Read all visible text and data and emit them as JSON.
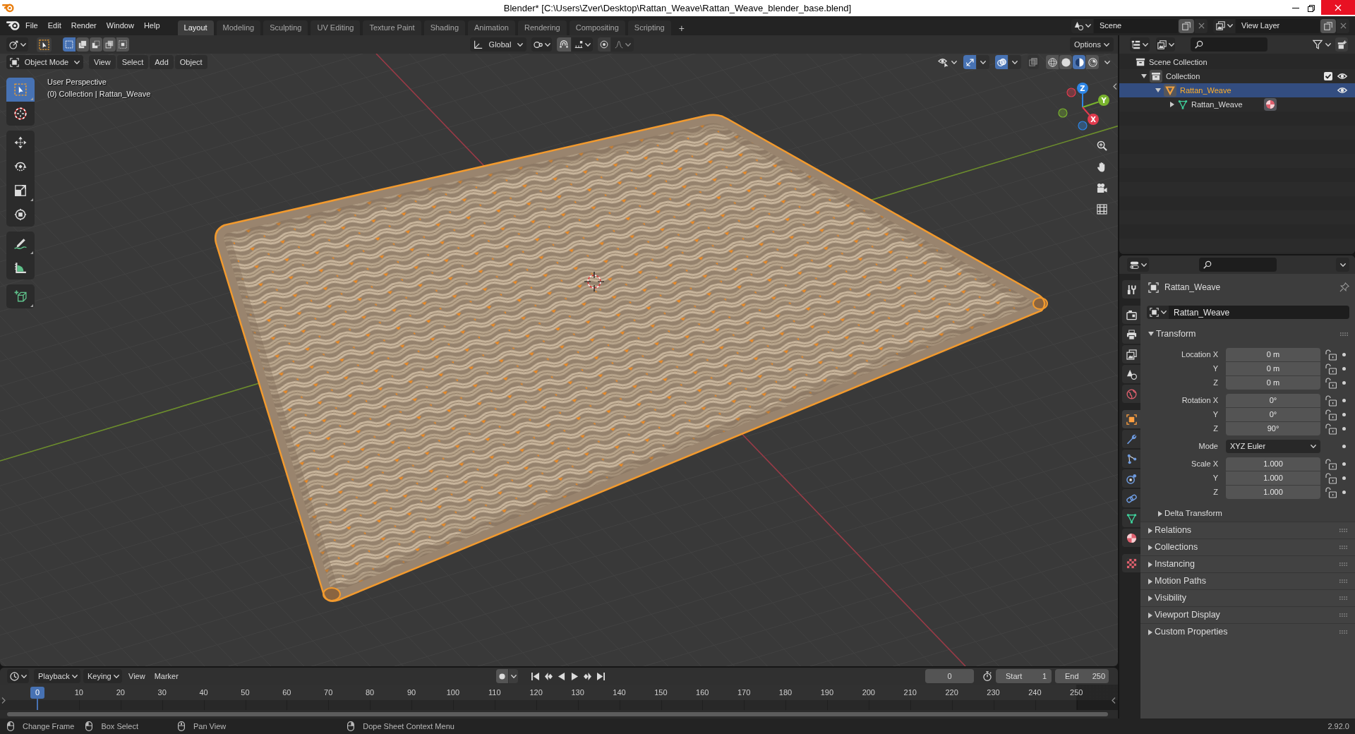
{
  "title_bar": {
    "title": "Blender* [C:\\Users\\Zver\\Desktop\\Rattan_Weave\\Rattan_Weave_blender_base.blend]"
  },
  "top_bar": {
    "menus": [
      "File",
      "Edit",
      "Render",
      "Window",
      "Help"
    ],
    "workspaces": [
      {
        "label": "Layout",
        "selected": true
      },
      {
        "label": "Modeling",
        "selected": false
      },
      {
        "label": "Sculpting",
        "selected": false
      },
      {
        "label": "UV Editing",
        "selected": false
      },
      {
        "label": "Texture Paint",
        "selected": false
      },
      {
        "label": "Shading",
        "selected": false
      },
      {
        "label": "Animation",
        "selected": false
      },
      {
        "label": "Rendering",
        "selected": false
      },
      {
        "label": "Compositing",
        "selected": false
      },
      {
        "label": "Scripting",
        "selected": false
      }
    ],
    "add_workspace": "+",
    "scene": "Scene",
    "view_layer": "View Layer"
  },
  "viewport": {
    "tool_header": {
      "select_modes": [
        {
          "kind": "set",
          "selected": true
        },
        {
          "kind": "extend",
          "selected": false
        },
        {
          "kind": "subtract",
          "selected": false
        },
        {
          "kind": "difference",
          "selected": false
        },
        {
          "kind": "intersect",
          "selected": false
        }
      ],
      "orientation": "Global",
      "options": "Options"
    },
    "header": {
      "mode": "Object Mode",
      "menus": [
        "View",
        "Select",
        "Add",
        "Object"
      ],
      "show_gizmos": true,
      "show_overlays": true,
      "xray": false,
      "shading": [
        {
          "kind": "wireframe",
          "selected": false
        },
        {
          "kind": "solid",
          "selected": false
        },
        {
          "kind": "material",
          "selected": true
        },
        {
          "kind": "rendered",
          "selected": false
        }
      ]
    },
    "tool_groups": [
      {
        "tools": [
          {
            "kind": "select_box",
            "selected": true
          },
          {
            "kind": "cursor",
            "selected": false
          }
        ]
      },
      {
        "tools": [
          {
            "kind": "move",
            "selected": false
          },
          {
            "kind": "rotate",
            "selected": false
          },
          {
            "kind": "scale",
            "selected": false
          },
          {
            "kind": "transform",
            "selected": false
          }
        ]
      },
      {
        "tools": [
          {
            "kind": "annotate",
            "selected": false
          },
          {
            "kind": "measure",
            "selected": false
          }
        ]
      },
      {
        "tools": [
          {
            "kind": "add_cube",
            "selected": false
          }
        ]
      }
    ],
    "info": [
      "User Perspective",
      "(0) Collection | Rattan_Weave"
    ],
    "gizmo_axes": [
      {
        "label": "Z",
        "color": "#2e86e6"
      },
      {
        "label": "Y",
        "color": "#79b32e"
      },
      {
        "label": "X",
        "color": "#e23b4e"
      }
    ]
  },
  "outliner": {
    "tree": [
      {
        "label": "Scene Collection",
        "kind": "scene_collection",
        "selected": false,
        "children": [
          {
            "label": "Collection",
            "kind": "collection",
            "selected": false,
            "expanded": true,
            "checked": true,
            "visible": true,
            "children": [
              {
                "label": "Rattan_Weave",
                "kind": "object",
                "selected": true,
                "expanded": true,
                "visible": true,
                "children": [
                  {
                    "label": "Rattan_Weave",
                    "kind": "mesh",
                    "selected": false,
                    "expanded": false
                  }
                ]
              }
            ]
          }
        ]
      }
    ]
  },
  "properties": {
    "tabs": [
      {
        "kind": "tool",
        "selected": false
      },
      {
        "kind": "render",
        "selected": false
      },
      {
        "kind": "output",
        "selected": false
      },
      {
        "kind": "view_layer",
        "selected": false
      },
      {
        "kind": "scene",
        "selected": false
      },
      {
        "kind": "world",
        "selected": false
      },
      {
        "kind": "object",
        "selected": true
      },
      {
        "kind": "modifiers",
        "selected": false
      },
      {
        "kind": "particles",
        "selected": false
      },
      {
        "kind": "physics",
        "selected": false
      },
      {
        "kind": "constraints",
        "selected": false
      },
      {
        "kind": "data",
        "selected": false
      },
      {
        "kind": "material",
        "selected": false
      },
      {
        "kind": "texture",
        "selected": false
      }
    ],
    "context": "Rattan_Weave",
    "name": "Rattan_Weave",
    "transform": {
      "title": "Transform",
      "expanded": true,
      "groups": [
        {
          "kind": "vector",
          "rows": [
            {
              "label": "Location X",
              "value": "0 m",
              "locked": false
            },
            {
              "label": "Y",
              "value": "0 m",
              "locked": false
            },
            {
              "label": "Z",
              "value": "0 m",
              "locked": false
            }
          ]
        },
        {
          "kind": "vector",
          "rows": [
            {
              "label": "Rotation X",
              "value": "0°",
              "locked": false
            },
            {
              "label": "Y",
              "value": "0°",
              "locked": false
            },
            {
              "label": "Z",
              "value": "90°",
              "locked": false
            }
          ]
        },
        {
          "kind": "enum",
          "rows": [
            {
              "label": "Mode",
              "value": "XYZ Euler"
            }
          ]
        },
        {
          "kind": "vector",
          "rows": [
            {
              "label": "Scale X",
              "value": "1.000",
              "locked": false
            },
            {
              "label": "Y",
              "value": "1.000",
              "locked": false
            },
            {
              "label": "Z",
              "value": "1.000",
              "locked": false
            }
          ]
        }
      ],
      "subpanels": [
        {
          "title": "Delta Transform",
          "expanded": false
        }
      ]
    },
    "panels": [
      {
        "title": "Relations",
        "expanded": false
      },
      {
        "title": "Collections",
        "expanded": false
      },
      {
        "title": "Instancing",
        "expanded": false
      },
      {
        "title": "Motion Paths",
        "expanded": false
      },
      {
        "title": "Visibility",
        "expanded": false
      },
      {
        "title": "Viewport Display",
        "expanded": false
      },
      {
        "title": "Custom Properties",
        "expanded": false
      }
    ]
  },
  "timeline": {
    "menus": [
      {
        "label": "Playback",
        "kind": "dropdown"
      },
      {
        "label": "Keying",
        "kind": "dropdown"
      },
      {
        "label": "View",
        "kind": "menu"
      },
      {
        "label": "Marker",
        "kind": "menu"
      }
    ],
    "auto_keying": false,
    "current_frame": "0",
    "start_label": "Start",
    "start": "1",
    "end_label": "End",
    "end": "250",
    "playhead": "0",
    "ticks": [
      "10",
      "20",
      "30",
      "40",
      "50",
      "60",
      "70",
      "80",
      "90",
      "100",
      "110",
      "120",
      "130",
      "140",
      "150",
      "160",
      "170",
      "180",
      "190",
      "200",
      "210",
      "220",
      "230",
      "240",
      "250"
    ]
  },
  "status_bar": {
    "hints": [
      {
        "kind": "left_click",
        "label": "Change Frame"
      },
      {
        "kind": "left_drag",
        "label": "Box Select"
      },
      {
        "kind": "middle_click",
        "label": "Pan View"
      },
      {
        "kind": "right_click",
        "label": "Dope Sheet Context Menu"
      }
    ],
    "version": "2.92.0"
  }
}
